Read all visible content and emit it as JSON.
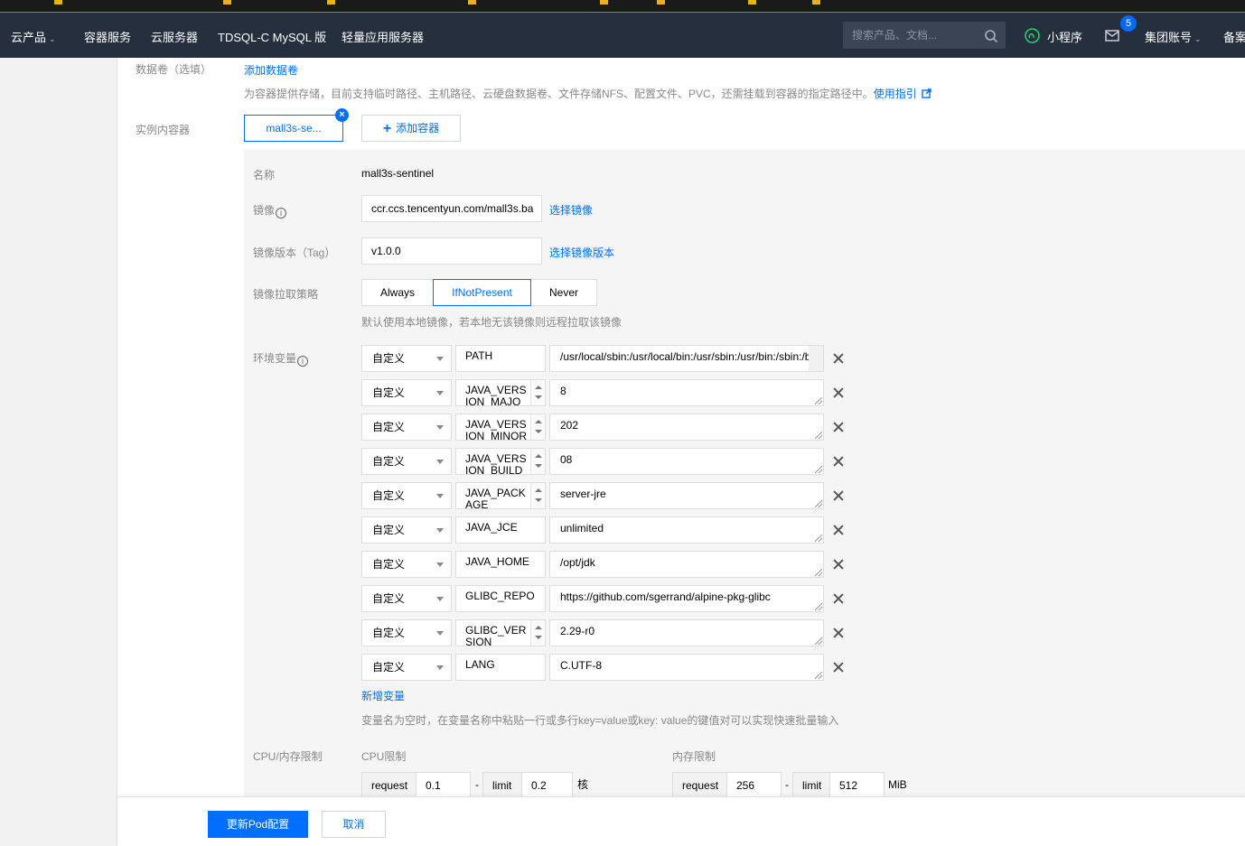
{
  "topbar": {
    "nav": [
      "云产品",
      "容器服务",
      "云服务器",
      "TDSQL-C MySQL 版",
      "轻量应用服务器"
    ],
    "search_placeholder": "搜索产品、文档...",
    "mini_program": "小程序",
    "mail_badge": "5",
    "account": "集团账号",
    "beian": "备案"
  },
  "volume": {
    "label": "数据卷（选填）",
    "add_link": "添加数据卷",
    "hint": "为容器提供存储，目前支持临时路径、主机路径、云硬盘数据卷、文件存储NFS、配置文件、PVC，还需挂载到容器的指定路径中。",
    "guide_link": "使用指引"
  },
  "containers": {
    "label": "实例内容器",
    "tab": "mall3s-se...",
    "add_button": "添加容器"
  },
  "form": {
    "name_label": "名称",
    "name_value": "mall3s-sentinel",
    "image_label": "镜像",
    "image_value": "ccr.ccs.tencentyun.com/mall3s.ba",
    "select_image": "选择镜像",
    "tag_label": "镜像版本（Tag）",
    "tag_value": "v1.0.0",
    "select_tag": "选择镜像版本",
    "pull_label": "镜像拉取策略",
    "pull_options": [
      "Always",
      "IfNotPresent",
      "Never"
    ],
    "pull_selected": "IfNotPresent",
    "pull_hint": "默认使用本地镜像，若本地无该镜像则远程拉取该镜像",
    "env_label": "环境变量",
    "env": [
      {
        "type": "自定义",
        "key": "PATH",
        "value": "/usr/local/sbin:/usr/local/bin:/usr/sbin:/usr/bin:/sbin:/bin:/opt/jdk/bin"
      },
      {
        "type": "自定义",
        "key": "JAVA_VERSION_MAJOR",
        "value": "8"
      },
      {
        "type": "自定义",
        "key": "JAVA_VERSION_MINOR",
        "value": "202"
      },
      {
        "type": "自定义",
        "key": "JAVA_VERSION_BUILD",
        "value": "08"
      },
      {
        "type": "自定义",
        "key": "JAVA_PACKAGE",
        "value": "server-jre"
      },
      {
        "type": "自定义",
        "key": "JAVA_JCE",
        "value": "unlimited"
      },
      {
        "type": "自定义",
        "key": "JAVA_HOME",
        "value": "/opt/jdk"
      },
      {
        "type": "自定义",
        "key": "GLIBC_REPO",
        "value": "https://github.com/sgerrand/alpine-pkg-glibc"
      },
      {
        "type": "自定义",
        "key": "GLIBC_VERSION",
        "value": "2.29-r0"
      },
      {
        "type": "自定义",
        "key": "LANG",
        "value": "C.UTF-8"
      }
    ],
    "add_env": "新增变量",
    "env_hint": "变量名为空时，在变量名称中粘贴一行或多行key=value或key: value的键值对可以实现快速批量输入",
    "cpu_mem_label": "CPU/内存限制",
    "cpu_label": "CPU限制",
    "mem_label": "内存限制",
    "request": "request",
    "limit": "limit",
    "dash": "-",
    "cpu_request": "0.1",
    "cpu_limit": "0.2",
    "cpu_unit": "核",
    "mem_request": "256",
    "mem_limit": "512",
    "mem_unit": "MiB"
  },
  "footer": {
    "update": "更新Pod配置",
    "cancel": "取消"
  },
  "colors": {
    "accent": "#006eff",
    "topbar": "#262f3e"
  }
}
